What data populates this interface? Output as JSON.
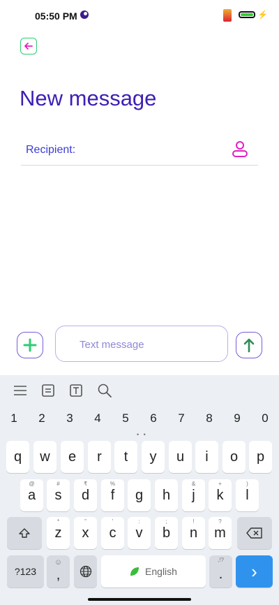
{
  "status_bar": {
    "time": "05:50 PM"
  },
  "header": {
    "title": "New message"
  },
  "recipient": {
    "label": "Recipient:"
  },
  "compose": {
    "placeholder": "Text message"
  },
  "keyboard": {
    "numbers": [
      "1",
      "2",
      "3",
      "4",
      "5",
      "6",
      "7",
      "8",
      "9",
      "0"
    ],
    "row1": [
      "q",
      "w",
      "e",
      "r",
      "t",
      "y",
      "u",
      "i",
      "o",
      "p"
    ],
    "row2": [
      "a",
      "s",
      "d",
      "f",
      "g",
      "h",
      "j",
      "k",
      "l"
    ],
    "row2_hints": [
      "@",
      "#",
      "₹",
      "",
      "%",
      "",
      "",
      "+",
      "("
    ],
    "row3": [
      "z",
      "x",
      "c",
      "v",
      "b",
      "n",
      "m"
    ],
    "row3_hints": [
      "*",
      "\"",
      "'",
      "",
      "",
      "",
      ""
    ],
    "row2_hint_j": "&",
    "row2_hint_l": ")",
    "row3_hint_c": ":",
    "row3_hint_v": "",
    "row3_hint_b": ";",
    "row3_hint_n": "!",
    "row3_hint_m": "?",
    "symbols_label": "?123",
    "comma_label": ",",
    "period_label": ".",
    "period_hint": ",!?",
    "space_label": "English",
    "enter_label": "›"
  },
  "colors": {
    "accent": "#3e1fb3",
    "link": "#3b3bd9",
    "green": "#2ecc71",
    "magenta": "#e020c0",
    "enter": "#2f93ee"
  }
}
